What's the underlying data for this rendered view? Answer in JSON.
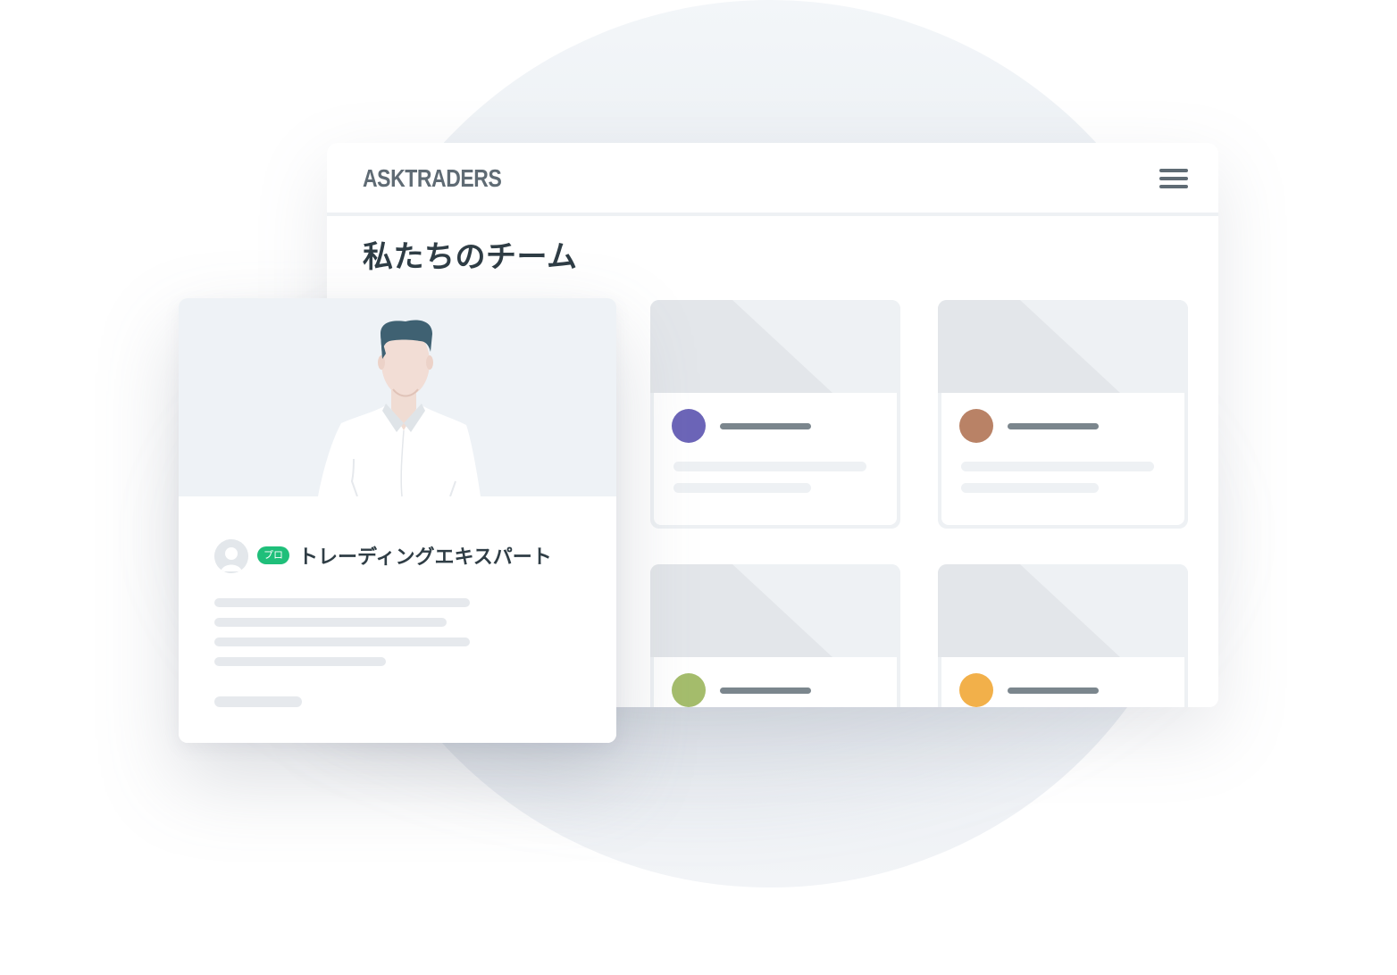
{
  "header": {
    "logo_text": "ASKTRADERS",
    "menu_icon": "hamburger-menu-icon"
  },
  "main": {
    "page_title": "私たちのチーム"
  },
  "featured_card": {
    "badge": "プロ",
    "title": "トレーディングエキスパート",
    "avatar_icon": "user-avatar-icon"
  },
  "team_cards": [
    {
      "avatar_color": "#6c65b8"
    },
    {
      "avatar_color": "#b98266"
    },
    {
      "avatar_color": "#a5bd6c"
    },
    {
      "avatar_color": "#f2b04a"
    }
  ],
  "colors": {
    "brand_text": "#5f6b74",
    "title_text": "#2f3d45",
    "badge_green": "#1fbf7a"
  }
}
